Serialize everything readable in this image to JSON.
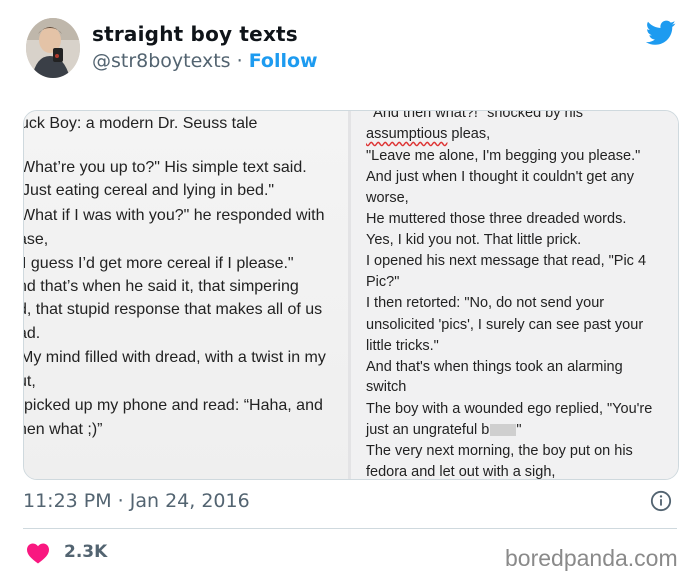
{
  "tweet": {
    "display_name": "straight boy texts",
    "handle": "@str8boytexts",
    "separator": " · ",
    "follow_label": "Follow",
    "timestamp": "11:23 PM · Jan 24, 2016",
    "likes": "2.3K"
  },
  "image_left": [
    "uck Boy: a modern Dr. Seuss tale",
    "What’re you up to?\" His simple text said.",
    "Just eating cereal and lying in bed.\"",
    "What if I was with you?\" he responded with",
    "ase,",
    "I guess I’d get more cereal if I please.\"",
    "nd that’s when he said it, that simpering",
    "d, that stupid response that makes all of us",
    "ad.",
    "My mind filled with dread, with a twist in my",
    "ut,",
    "picked up my phone and read: “Haha, and",
    "hen what ;)”"
  ],
  "image_right": [
    "\"And then what?!\" shocked by his",
    "assumptious",
    " pleas,",
    "\"Leave me alone, I'm begging you please.\"",
    "And just when I thought it couldn't get any",
    "worse,",
    "He muttered those three dreaded words.",
    "Yes, I kid you not. That little prick.",
    "I opened his next message that read, \"Pic 4",
    "Pic?\"",
    "I then retorted: \"No, do not send your",
    "unsolicited 'pics', I surely can see past your",
    "little tricks.\"",
    "And that's when things took an alarming",
    "switch",
    "The boy with a wounded ego replied, \"You're",
    "just an ungrateful b",
    "\"",
    "The very next morning, the boy put on his",
    "fedora and let out with a sigh,"
  ],
  "watermark": "boredpanda.com",
  "colors": {
    "accent": "#1d9bf0",
    "heart": "#f91880",
    "muted": "#536471"
  },
  "icons": [
    "twitter-bird-icon",
    "info-icon",
    "heart-icon"
  ]
}
